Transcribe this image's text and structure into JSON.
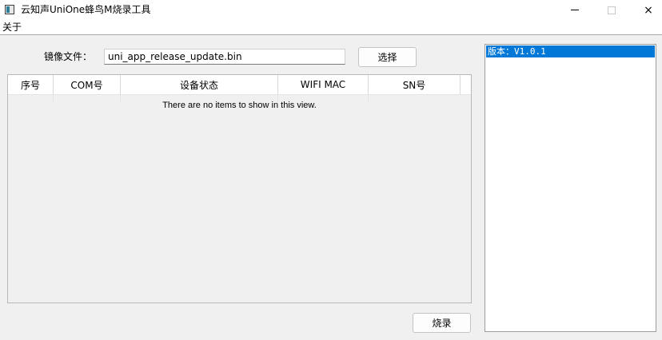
{
  "window": {
    "title": "云知声UniOne蜂鸟M烧录工具",
    "icon": "app-icon",
    "controls": {
      "minimize": "minimize-icon",
      "maximize": "maximize-icon",
      "close": "×"
    }
  },
  "menubar": {
    "items": [
      {
        "label": "关于"
      }
    ]
  },
  "image_file": {
    "label": "镜像文件：",
    "value": "uni_app_release_update.bin",
    "select_label": "选择"
  },
  "table": {
    "columns": [
      "序号",
      "COM号",
      "设备状态",
      "WIFI MAC",
      "SN号"
    ],
    "rows": [],
    "empty_text": "There are no items to show in this view."
  },
  "actions": {
    "burn_label": "烧录"
  },
  "version_list": {
    "items": [
      "版本：V1.0.1"
    ],
    "selected_index": 0,
    "selected_color": "#0078d7"
  }
}
